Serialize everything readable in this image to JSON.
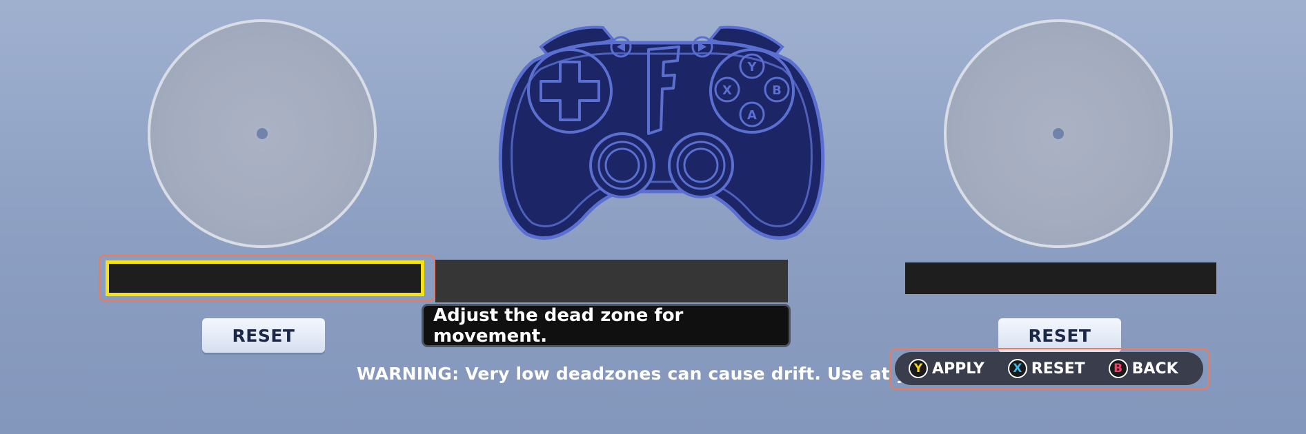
{
  "screen": {
    "description_tooltip": "Adjust the dead zone for movement.",
    "warning": "WARNING: Very low deadzones can cause drift. Use at your own risk."
  },
  "left_stick": {
    "reset_label": "RESET"
  },
  "right_stick": {
    "reset_label": "RESET"
  },
  "prompts": [
    {
      "button": "Y",
      "label": "APPLY",
      "color": "#f3d21a"
    },
    {
      "button": "X",
      "label": "RESET",
      "color": "#3fb6e8"
    },
    {
      "button": "B",
      "label": "BACK",
      "color": "#e8456a"
    }
  ],
  "controller": {
    "logo_letter": "F",
    "face_buttons": [
      "Y",
      "X",
      "B",
      "A"
    ]
  },
  "colors": {
    "focus_yellow": "#f3e21a",
    "focus_ring": "#ef7a55",
    "controller_fill": "#1c2566",
    "controller_outline": "#5a6fd0"
  }
}
